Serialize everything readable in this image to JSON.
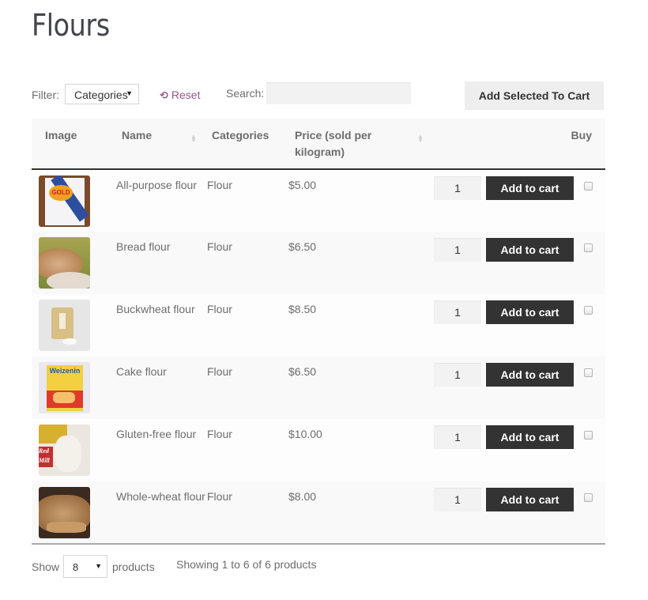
{
  "page": {
    "title": "Flours"
  },
  "toolbar": {
    "filter_label": "Filter:",
    "filter_select_value": "Categories",
    "reset_label": "Reset",
    "search_label": "Search:",
    "search_value": "",
    "add_selected_label": "Add Selected To Cart"
  },
  "table": {
    "headers": {
      "image": "Image",
      "name": "Name",
      "categories": "Categories",
      "price": "Price (sold per kilogram)",
      "buy": "Buy"
    },
    "rows": [
      {
        "name": "All-purpose flour",
        "category": "Flour",
        "price": "$5.00",
        "qty": "1",
        "add_label": "Add to cart",
        "checked": false,
        "image": "gold-medal-flour-bag"
      },
      {
        "name": "Bread flour",
        "category": "Flour",
        "price": "$6.50",
        "qty": "1",
        "add_label": "Add to cart",
        "checked": false,
        "image": "bread-loaf"
      },
      {
        "name": "Buckwheat flour",
        "category": "Flour",
        "price": "$8.50",
        "qty": "1",
        "add_label": "Add to cart",
        "checked": false,
        "image": "buckwheat-bag"
      },
      {
        "name": "Cake flour",
        "category": "Flour",
        "price": "$6.50",
        "qty": "1",
        "add_label": "Add to cart",
        "checked": false,
        "image": "weizenin-box"
      },
      {
        "name": "Gluten-free flour",
        "category": "Flour",
        "price": "$10.00",
        "qty": "1",
        "add_label": "Add to cart",
        "checked": false,
        "image": "red-mill-bag"
      },
      {
        "name": "Whole-wheat flour",
        "category": "Flour",
        "price": "$8.00",
        "qty": "1",
        "add_label": "Add to cart",
        "checked": false,
        "image": "wheat-bread"
      }
    ]
  },
  "footer": {
    "show_label": "Show",
    "show_value": "8",
    "products_label": "products",
    "showing_info": "Showing 1 to 6 of 6 products"
  },
  "colors": {
    "accent_link": "#96588a",
    "button_dark": "#333333",
    "header_bg": "#f8f8f8"
  }
}
